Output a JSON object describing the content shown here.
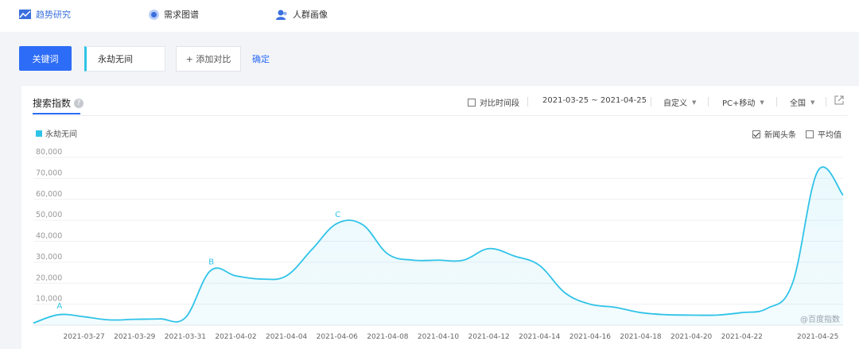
{
  "nav": {
    "items": [
      {
        "label": "趋势研究",
        "icon": "trend-icon"
      },
      {
        "label": "需求图谱",
        "icon": "graph-icon"
      },
      {
        "label": "人群画像",
        "icon": "people-icon"
      }
    ]
  },
  "search": {
    "keyword_button": "关键词",
    "keyword": "永劫无间",
    "add_compare": "+ 添加对比",
    "confirm": "确定"
  },
  "panel": {
    "tab": "搜索指数",
    "help": "?",
    "compare_period": "对比时间段",
    "date_range": "2021-03-25 ~ 2021-04-25",
    "custom": "自定义",
    "device": "PC+移动",
    "region": "全国",
    "news": "新闻头条",
    "average": "平均值",
    "watermark": "@百度指数"
  },
  "colors": {
    "accent": "#2d6cf6",
    "series": "#2fc3e8"
  },
  "chart_data": {
    "type": "area",
    "series": [
      {
        "name": "永劫无间",
        "color": "#2fc3e8",
        "points": [
          [
            "2021-03-25",
            1000
          ],
          [
            "2021-03-26",
            5000
          ],
          [
            "2021-03-27",
            4000
          ],
          [
            "2021-03-28",
            2500
          ],
          [
            "2021-03-29",
            2800
          ],
          [
            "2021-03-30",
            3000
          ],
          [
            "2021-03-31",
            3500
          ],
          [
            "2021-04-01",
            26000
          ],
          [
            "2021-04-02",
            23500
          ],
          [
            "2021-04-03",
            22000
          ],
          [
            "2021-04-04",
            23500
          ],
          [
            "2021-04-05",
            36000
          ],
          [
            "2021-04-06",
            48500
          ],
          [
            "2021-04-07",
            48000
          ],
          [
            "2021-04-08",
            34000
          ],
          [
            "2021-04-09",
            31000
          ],
          [
            "2021-04-10",
            31000
          ],
          [
            "2021-04-11",
            31000
          ],
          [
            "2021-04-12",
            36500
          ],
          [
            "2021-04-13",
            33000
          ],
          [
            "2021-04-14",
            28500
          ],
          [
            "2021-04-15",
            15500
          ],
          [
            "2021-04-16",
            10000
          ],
          [
            "2021-04-17",
            8500
          ],
          [
            "2021-04-18",
            6000
          ],
          [
            "2021-04-19",
            5000
          ],
          [
            "2021-04-20",
            4800
          ],
          [
            "2021-04-21",
            4800
          ],
          [
            "2021-04-22",
            6000
          ],
          [
            "2021-04-23",
            8000
          ],
          [
            "2021-04-24",
            20000
          ],
          [
            "2021-04-25",
            73500
          ],
          [
            "2021-04-26",
            62000
          ]
        ]
      }
    ],
    "x_tick_labels": [
      "2021-03-27",
      "2021-03-29",
      "2021-03-31",
      "2021-04-02",
      "2021-04-04",
      "2021-04-06",
      "2021-04-08",
      "2021-04-10",
      "2021-04-12",
      "2021-04-14",
      "2021-04-16",
      "2021-04-18",
      "2021-04-20",
      "2021-04-22",
      "2021-04-25"
    ],
    "y_ticks": [
      10000,
      20000,
      30000,
      40000,
      50000,
      60000,
      70000,
      80000
    ],
    "y_tick_labels": [
      "10,000",
      "20,000",
      "30,000",
      "40,000",
      "50,000",
      "60,000",
      "70,000",
      "80,000"
    ],
    "ylim": [
      0,
      80000
    ],
    "annotations": [
      {
        "label": "A",
        "x": "2021-03-26",
        "y": 5000
      },
      {
        "label": "B",
        "x": "2021-04-01",
        "y": 26000
      },
      {
        "label": "C",
        "x": "2021-04-06",
        "y": 48500
      }
    ],
    "grid": true,
    "legend": "top-left"
  }
}
